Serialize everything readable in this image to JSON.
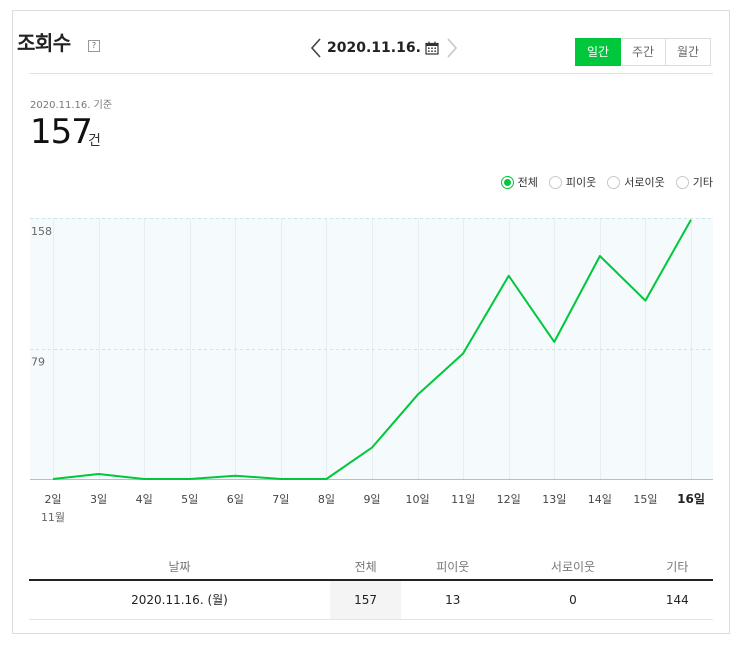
{
  "header": {
    "title": "조회수",
    "help_label": "?",
    "date": "2020.11.16.",
    "periods": [
      {
        "label": "일간",
        "active": true
      },
      {
        "label": "주간",
        "active": false
      },
      {
        "label": "월간",
        "active": false
      }
    ]
  },
  "summary": {
    "base_date": "2020.11.16. 기준",
    "count": "157",
    "unit": "건"
  },
  "filters": [
    {
      "label": "전체",
      "selected": true
    },
    {
      "label": "피이웃",
      "selected": false
    },
    {
      "label": "서로이웃",
      "selected": false
    },
    {
      "label": "기타",
      "selected": false
    }
  ],
  "chart_data": {
    "type": "line",
    "categories": [
      "2일",
      "3일",
      "4일",
      "5일",
      "6일",
      "7일",
      "8일",
      "9일",
      "10일",
      "11일",
      "12일",
      "13일",
      "14일",
      "15일",
      "16일"
    ],
    "month_label": "11월",
    "series": [
      {
        "values": [
          0,
          3,
          0,
          0,
          2,
          0,
          0,
          19,
          51,
          76,
          123,
          83,
          135,
          108,
          157
        ]
      }
    ],
    "yticks": [
      "158",
      "79"
    ],
    "ylim": [
      0,
      158
    ],
    "grid": true,
    "line_color": "#00c73c",
    "bold_category": "16일"
  },
  "table": {
    "headers": [
      "날짜",
      "전체",
      "피이웃",
      "서로이웃",
      "기타"
    ],
    "rows": [
      [
        "2020.11.16. (월)",
        "157",
        "13",
        "0",
        "144"
      ]
    ]
  },
  "colors": {
    "accent": "#00c73c"
  }
}
